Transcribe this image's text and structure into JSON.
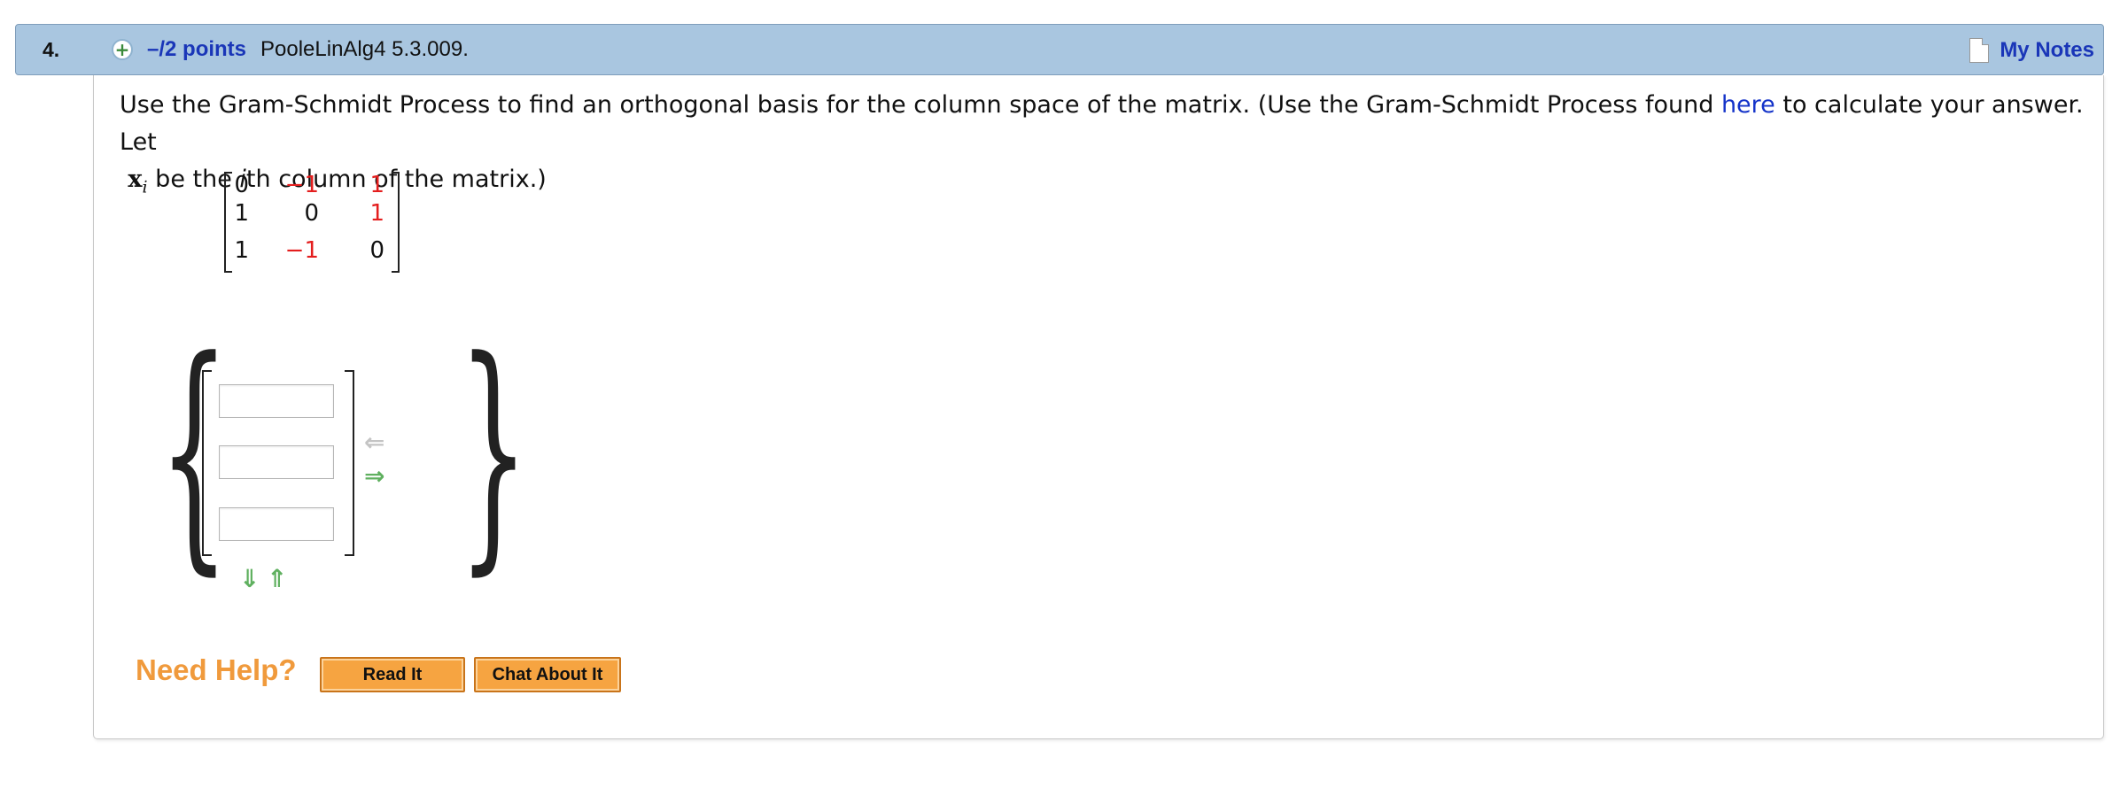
{
  "header": {
    "question_number": "4.",
    "points": "–/2 points",
    "problem_id": "PooleLinAlg4 5.3.009.",
    "my_notes_label": "My Notes"
  },
  "prompt": {
    "part1": "Use the Gram-Schmidt Process to find an orthogonal basis for the column space of the matrix. (Use the Gram-Schmidt Process found ",
    "link": "here",
    "part2": " to calculate your answer. Let",
    "x_var": "x",
    "x_sub": "i",
    "part3": " be the ",
    "ith": "i",
    "part4": "th column of the matrix.)"
  },
  "matrix": {
    "rows": [
      [
        "0",
        "−1",
        "1"
      ],
      [
        "1",
        "0",
        "1"
      ],
      [
        "1",
        "−1",
        "0"
      ]
    ],
    "highlight_color": "#e41e1e"
  },
  "answer": {
    "vector_entries": [
      "",
      "",
      ""
    ],
    "icons": {
      "remove_vector": "left-arrow-icon",
      "add_vector": "right-arrow-icon",
      "add_row": "down-arrow-icon",
      "remove_row": "up-arrow-icon"
    }
  },
  "help": {
    "label": "Need Help?",
    "read_it": "Read It",
    "chat_about_it": "Chat About It"
  },
  "colors": {
    "header_bg": "#a9c6e0",
    "link": "#1433c9",
    "button": "#f6a441",
    "help_text": "#f09a3c"
  }
}
